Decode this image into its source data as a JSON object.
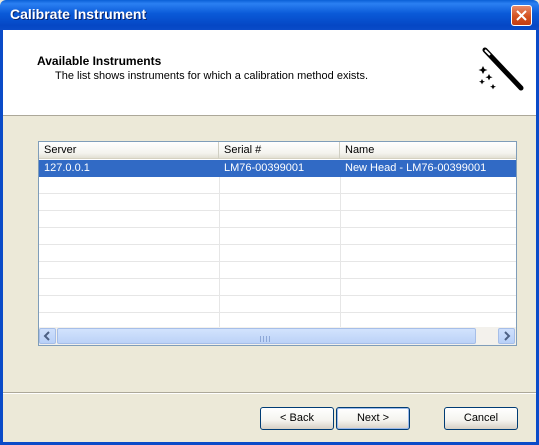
{
  "window": {
    "title": "Calibrate Instrument"
  },
  "header": {
    "title": "Available Instruments",
    "subtitle": "The list shows instruments for which a calibration method exists."
  },
  "instrument_list": {
    "columns": [
      "Server",
      "Serial #",
      "Name"
    ],
    "rows": [
      {
        "server": "127.0.0.1",
        "serial": "LM76-00399001",
        "name": "New Head - LM76-00399001",
        "selected": true
      }
    ]
  },
  "scrollbar": {
    "grip": "IIII"
  },
  "buttons": {
    "back": "< Back",
    "next": "Next >",
    "cancel": "Cancel"
  },
  "colors": {
    "titlebar": "#0a5ad8",
    "selection": "#316ac5",
    "close": "#d4521f"
  },
  "icons": {
    "close": "close-icon",
    "wizard": "magic-wand-icon",
    "scroll_left": "arrow-left-icon",
    "scroll_right": "arrow-right-icon"
  }
}
